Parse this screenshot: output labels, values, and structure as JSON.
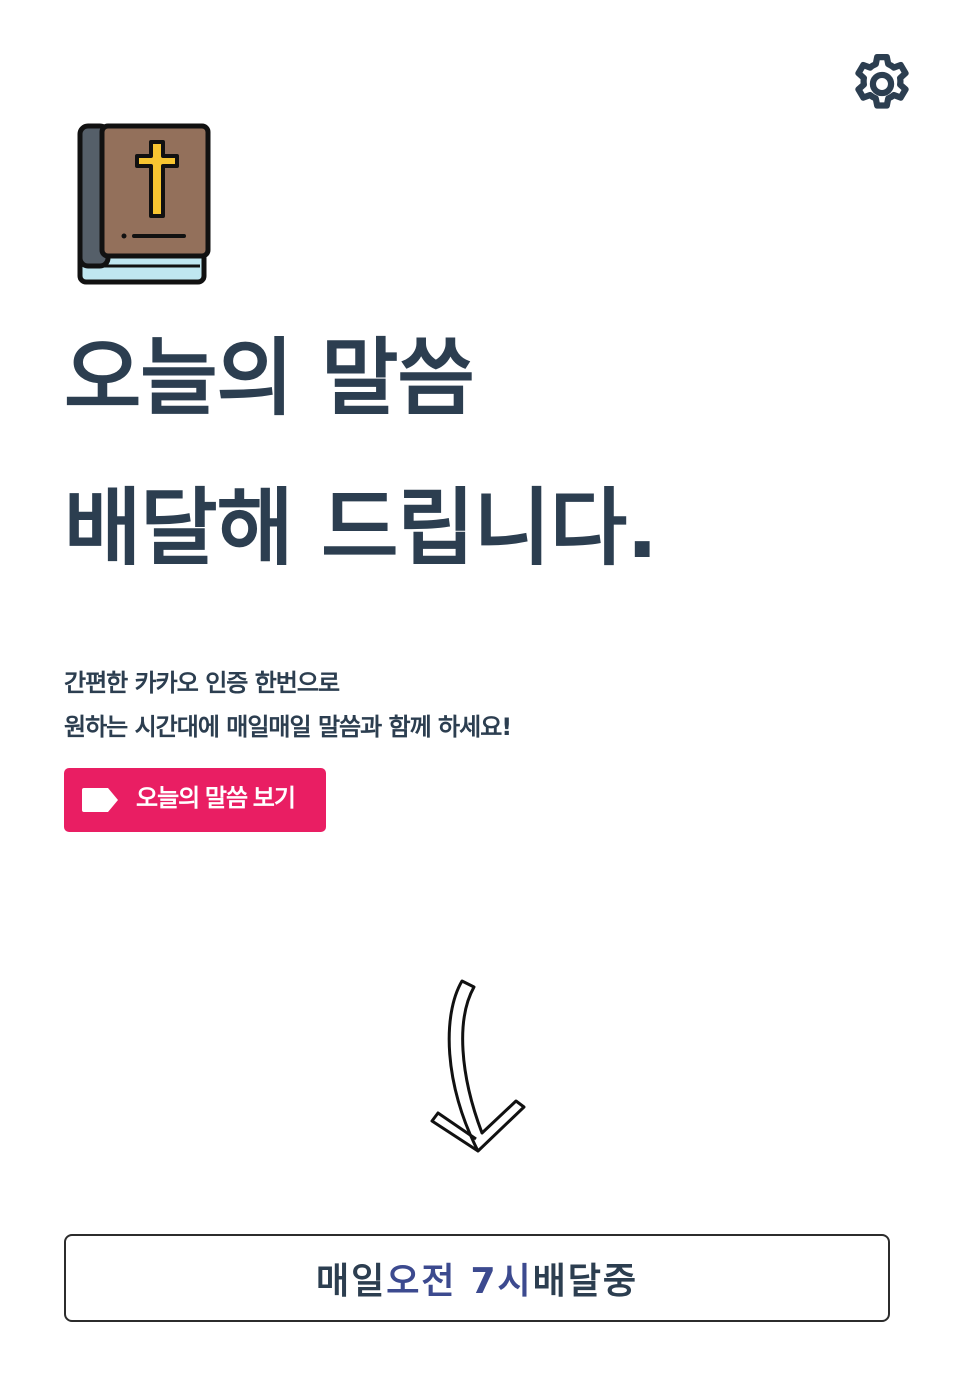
{
  "header": {
    "settings_icon": "gear-icon"
  },
  "hero": {
    "book_icon": "bible-icon",
    "title_line1": "오늘의 말씀",
    "title_line2": "배달해 드립니다."
  },
  "description": {
    "line1": "간편한 카카오 인증 한번으로",
    "line2": "원하는 시간대에 매일매일 말씀과 함께 하세요!"
  },
  "cta": {
    "icon": "tag-icon",
    "label": "오늘의 말씀 보기",
    "color": "#e91e63"
  },
  "decor": {
    "arrow_icon": "curved-arrow-down-icon"
  },
  "status": {
    "prefix": "매일",
    "time_period": "오전",
    "time_hour": "7시",
    "suffix": "배달중",
    "accent_color": "#3c4a8f"
  },
  "colors": {
    "text": "#2c3e50",
    "brand": "#e91e63"
  }
}
